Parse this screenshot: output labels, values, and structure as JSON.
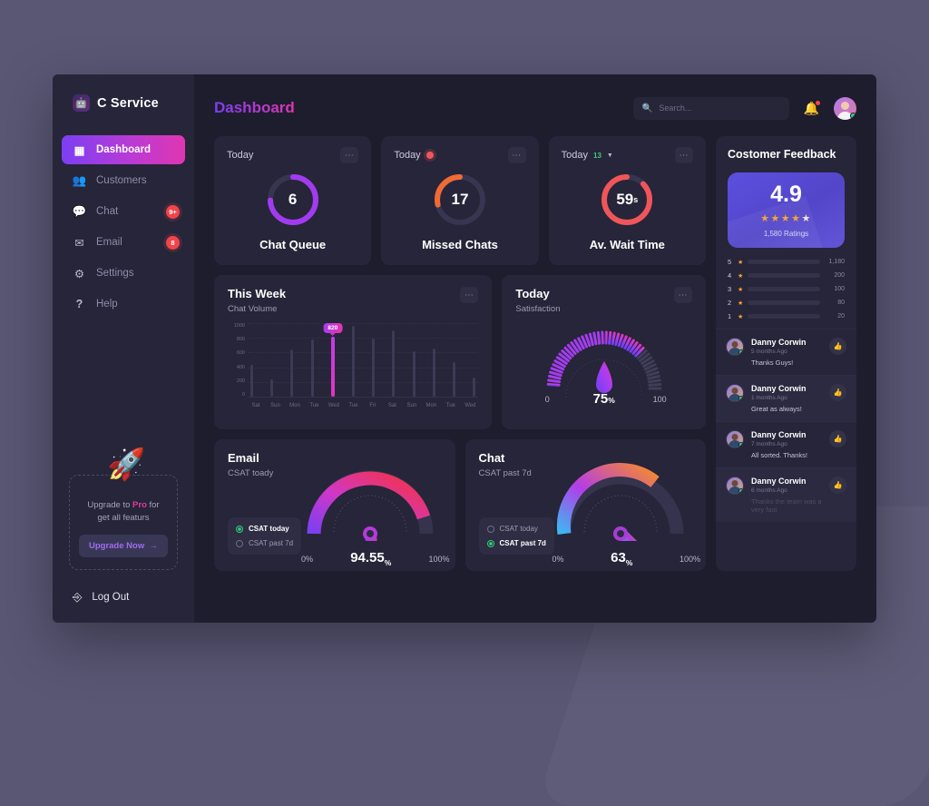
{
  "brand": {
    "name": "C Service",
    "logo_icon": "robot-icon"
  },
  "sidebar": {
    "items": [
      {
        "label": "Dashboard",
        "icon": "dashboard-icon",
        "badge": ""
      },
      {
        "label": "Customers",
        "icon": "customers-icon",
        "badge": ""
      },
      {
        "label": "Chat",
        "icon": "chat-icon",
        "badge": "9+"
      },
      {
        "label": "Email",
        "icon": "email-icon",
        "badge": "8"
      },
      {
        "label": "Settings",
        "icon": "gear-icon",
        "badge": ""
      },
      {
        "label": "Help",
        "icon": "help-icon",
        "badge": ""
      }
    ],
    "promo": {
      "icon": "rocket-icon",
      "line1_pre": "Upgrade to ",
      "line1_strong": "Pro",
      "line1_post": " for",
      "line2": "get all featurs",
      "button": "Upgrade Now",
      "button_arrow": "→"
    },
    "logout": {
      "label": "Log Out",
      "icon": "logout-icon"
    }
  },
  "header": {
    "title": "Dashboard",
    "search": {
      "placeholder": "Search...",
      "value": "",
      "icon": "search-icon"
    },
    "bell_icon": "bell-icon",
    "avatar": "user-avatar"
  },
  "stats": [
    {
      "period": "Today",
      "value": "6",
      "unit": "",
      "title": "Chat Queue",
      "indicator": "none",
      "trend": "",
      "color": "#a23bf0",
      "percent": 62
    },
    {
      "period": "Today",
      "value": "17",
      "unit": "",
      "title": "Missed Chats",
      "indicator": "dot",
      "trend": "",
      "color": "#f06a36",
      "percent": 70
    },
    {
      "period": "Today",
      "value": "59",
      "unit": "s",
      "title": "Av. Wait Time",
      "indicator": "trend",
      "trend": "13",
      "color": "#f0555a",
      "percent": 80
    }
  ],
  "week": {
    "title": "This Week",
    "subtitle": "Chat Volume",
    "menu_icon": "more-icon"
  },
  "satisfaction": {
    "title": "Today",
    "subtitle": "Satisfaction",
    "value": "75",
    "unit": "%",
    "min": "0",
    "max": "100",
    "menu_icon": "more-icon"
  },
  "gauges": [
    {
      "title": "Email",
      "subtitle": "CSAT toady",
      "value": "94.55",
      "unit": "%",
      "min": "0%",
      "max": "100%",
      "percent": 94.55,
      "legend": [
        {
          "label": "CSAT today",
          "selected": true
        },
        {
          "label": "CSAT past 7d",
          "selected": false
        }
      ]
    },
    {
      "title": "Chat",
      "subtitle": "CSAT past 7d",
      "value": "63",
      "unit": "%",
      "min": "0%",
      "max": "100%",
      "percent": 63,
      "legend": [
        {
          "label": "CSAT today",
          "selected": false
        },
        {
          "label": "CSAT past 7d",
          "selected": true
        }
      ]
    }
  ],
  "feedback": {
    "title": "Costomer Feedback",
    "score": "4.9",
    "stars": 4.5,
    "ratings_label": "1,580 Ratings",
    "distribution": [
      {
        "stars": "5",
        "count": "1,180",
        "percent": 88
      },
      {
        "stars": "4",
        "count": "200",
        "percent": 58
      },
      {
        "stars": "3",
        "count": "100",
        "percent": 42
      },
      {
        "stars": "2",
        "count": "80",
        "percent": 22
      },
      {
        "stars": "1",
        "count": "20",
        "percent": 12
      }
    ],
    "reviews": [
      {
        "name": "Danny Corwin",
        "time": "5 months Ago",
        "message": "Thanks Guys!",
        "faded": false
      },
      {
        "name": "Danny Corwin",
        "time": "1 months Ago",
        "message": "Great as always!",
        "faded": false
      },
      {
        "name": "Danny Corwin",
        "time": "7 months Ago",
        "message": "All sorted. Thanks!",
        "faded": false
      },
      {
        "name": "Danny Corwin",
        "time": "6 months Ago",
        "message": "Thanks the team was a very fast",
        "faded": true
      }
    ],
    "thumb_icon": "thumbs-up-icon"
  },
  "chart_data": [
    {
      "type": "bar",
      "title": "This Week",
      "subtitle": "Chat Volume",
      "categories": [
        "Sat",
        "Sun",
        "Mon",
        "Tue",
        "Wed",
        "Tue",
        "Fri",
        "Sat",
        "Sun",
        "Mon",
        "Tue",
        "Wed"
      ],
      "values": [
        430,
        240,
        640,
        780,
        820,
        960,
        790,
        900,
        620,
        650,
        470,
        260
      ],
      "highlight_index": 4,
      "highlight_label": "820",
      "ylabel": "",
      "xlabel": "",
      "ylim": [
        0,
        1000
      ],
      "yticks": [
        1000,
        800,
        600,
        400,
        200,
        0
      ],
      "grid": true
    },
    {
      "type": "gauge",
      "title": "Today",
      "subtitle": "Satisfaction",
      "value": 75,
      "min": 0,
      "max": 100,
      "unit": "%"
    },
    {
      "type": "gauge",
      "title": "Email",
      "subtitle": "CSAT toady",
      "value": 94.55,
      "min": 0,
      "max": 100,
      "unit": "%"
    },
    {
      "type": "gauge",
      "title": "Chat",
      "subtitle": "CSAT past 7d",
      "value": 63,
      "min": 0,
      "max": 100,
      "unit": "%"
    },
    {
      "type": "bar",
      "title": "Costomer Feedback rating distribution",
      "categories": [
        "5 star",
        "4 star",
        "3 star",
        "2 star",
        "1 star"
      ],
      "values": [
        1180,
        200,
        100,
        80,
        20
      ],
      "ylabel": "",
      "xlabel": "",
      "grid": false
    }
  ]
}
